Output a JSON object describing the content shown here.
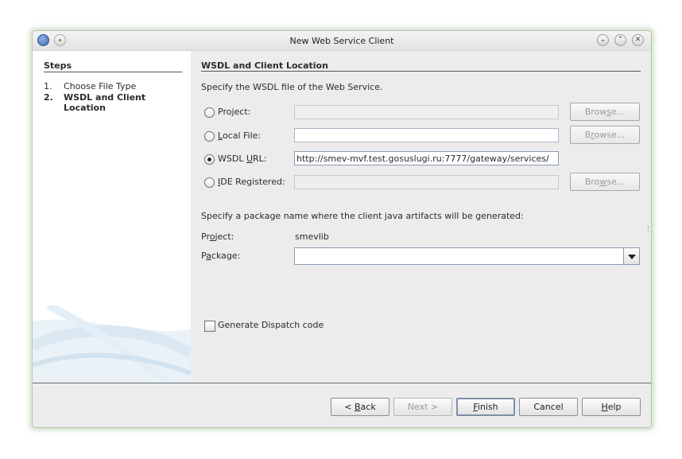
{
  "window": {
    "title": "New Web Service Client",
    "controls": {
      "minimize": "chevron-down-icon",
      "maximize": "chevron-up-icon",
      "close": "close-icon"
    }
  },
  "steps": {
    "title": "Steps",
    "items": [
      {
        "num": "1.",
        "label": "Choose File Type",
        "active": false
      },
      {
        "num": "2.",
        "label": "WSDL and Client Location",
        "active": true
      }
    ]
  },
  "content": {
    "title": "WSDL and Client Location",
    "instruction": "Specify the WSDL file of the Web Service.",
    "sources": [
      {
        "label": "Project:",
        "mnemonic_index": 3,
        "selected": false,
        "value": "",
        "enabled": false,
        "browse": "Browse...",
        "browse_enabled": false
      },
      {
        "label": "Local File:",
        "mnemonic_index": 0,
        "selected": false,
        "value": "",
        "enabled": true,
        "browse": "Browse...",
        "browse_enabled": false
      },
      {
        "label": "WSDL URL:",
        "mnemonic_index": 5,
        "selected": true,
        "value": "http://smev-mvf.test.gosuslugi.ru:7777/gateway/services/",
        "enabled": true
      },
      {
        "label": "IDE Registered:",
        "mnemonic_index": 0,
        "selected": false,
        "value": "",
        "enabled": false,
        "browse": "Browse...",
        "browse_enabled": false
      }
    ],
    "package_instruction": "Specify a package name where the client java artifacts will be generated:",
    "project_label": "Project:",
    "project_value": "smevlib",
    "package_label": "Package:",
    "package_value": "",
    "dispatch_label": "Generate Dispatch code",
    "dispatch_checked": false
  },
  "buttons": {
    "back": "< Back",
    "next": "Next >",
    "finish": "Finish",
    "cancel": "Cancel",
    "help": "Help"
  }
}
